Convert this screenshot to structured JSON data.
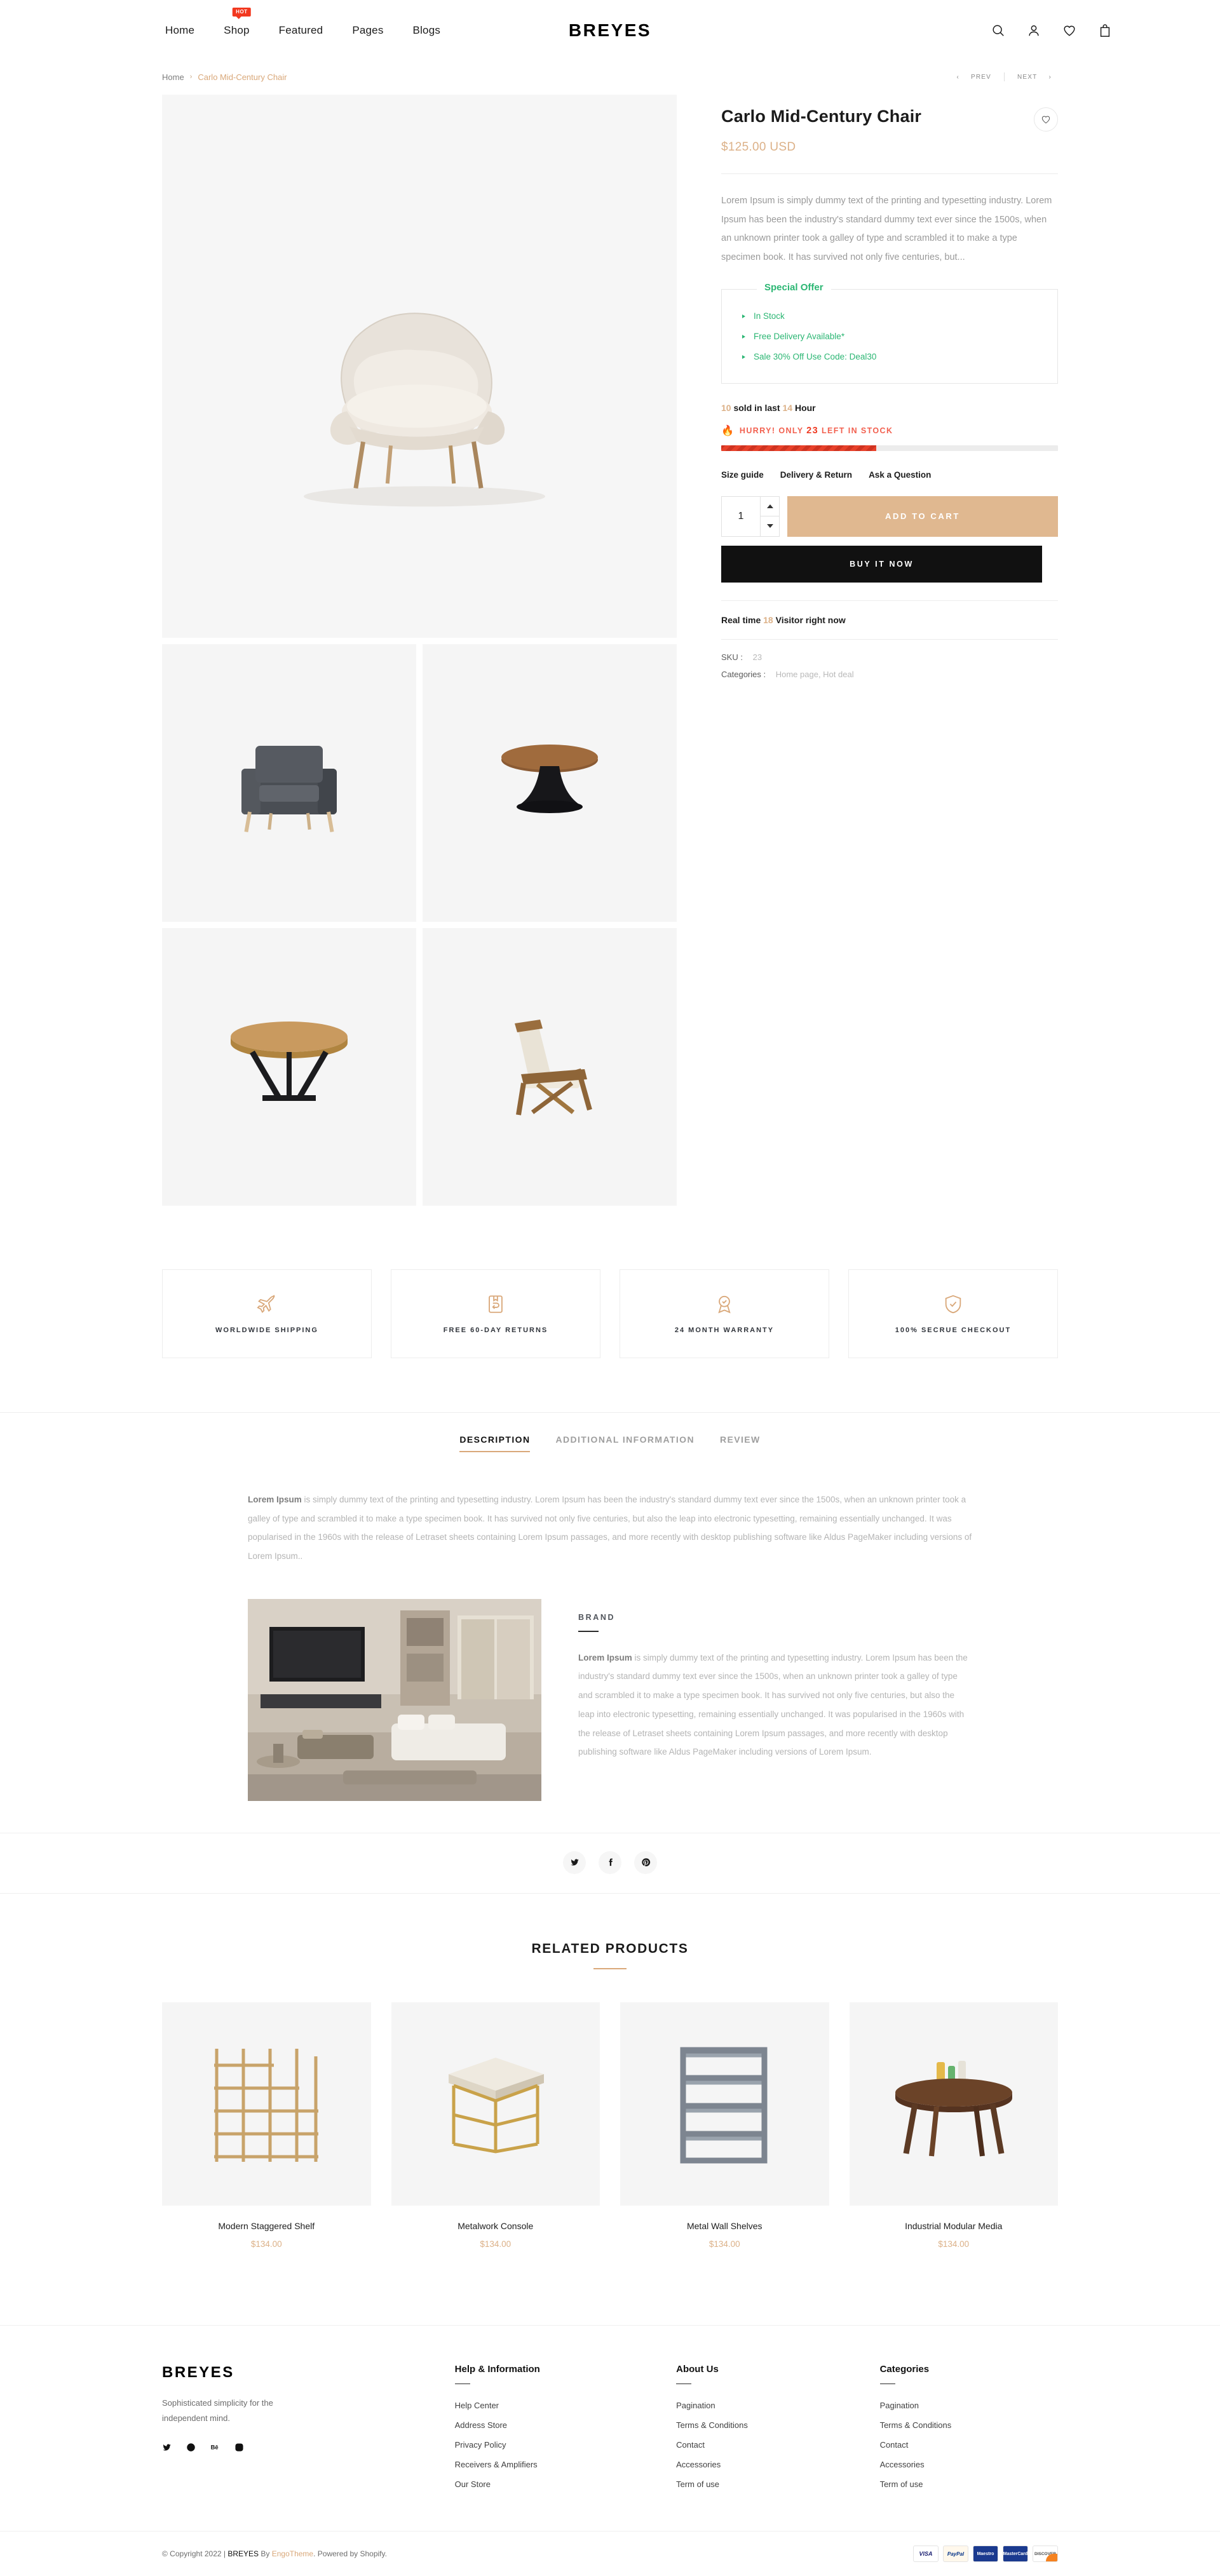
{
  "header": {
    "nav": [
      {
        "label": "Home",
        "badge": null
      },
      {
        "label": "Shop",
        "badge": "HOT"
      },
      {
        "label": "Featured",
        "badge": null
      },
      {
        "label": "Pages",
        "badge": null
      },
      {
        "label": "Blogs",
        "badge": null
      }
    ],
    "logo": "BREYES",
    "icons": [
      "search-icon",
      "account-icon",
      "wishlist-heart-icon",
      "cart-bag-icon"
    ]
  },
  "breadcrumb": {
    "home": "Home",
    "separator": "›",
    "current": "Carlo Mid-Century Chair",
    "prev": "PREV",
    "next": "NEXT"
  },
  "product": {
    "title": "Carlo Mid-Century Chair",
    "price": "$125.00 USD",
    "description": "Lorem Ipsum is simply dummy text of the printing and typesetting industry. Lorem Ipsum has been the industry's standard dummy text ever since the 1500s, when an unknown printer took a galley of type and scrambled it to make a type specimen book. It has survived not only five centuries, but...",
    "offer_title": "Special Offer",
    "offer_items": [
      "In Stock",
      "Free Delivery Available*",
      "Sale 30% Off Use Code: Deal30"
    ],
    "sold_count": "10",
    "sold_mid": "sold in last",
    "sold_hours": "14",
    "sold_unit": "Hour",
    "hurry_prefix": "HURRY! ONLY",
    "hurry_count": "23",
    "hurry_suffix": "LEFT IN STOCK",
    "stock_percent": 46,
    "links": [
      "Size guide",
      "Delivery & Return",
      "Ask a Question"
    ],
    "qty_value": "1",
    "add_to_cart": "ADD TO CART",
    "buy_now": "BUY IT NOW",
    "realtime_prefix": "Real time",
    "realtime_count": "18",
    "realtime_suffix": "Visitor right now",
    "sku_label": "SKU",
    "sku_value": "23",
    "categories_label": "Categories",
    "categories_value": "Home page, Hot deal",
    "accent_color": "#dcb188",
    "alert_color": "#ef3b23",
    "offer_color": "#2bb673"
  },
  "features": [
    {
      "icon": "airplane-icon",
      "label": "WORLDWIDE SHIPPING"
    },
    {
      "icon": "return-box-icon",
      "label": "FREE 60-DAY RETURNS"
    },
    {
      "icon": "award-badge-icon",
      "label": "24 MONTH WARRANTY"
    },
    {
      "icon": "shield-check-icon",
      "label": "100% SECRUE CHECKOUT"
    }
  ],
  "tabs": [
    {
      "label": "DESCRIPTION",
      "active": true
    },
    {
      "label": "ADDITIONAL INFORMATION",
      "active": false
    },
    {
      "label": "REVIEW",
      "active": false
    }
  ],
  "description_tab": {
    "lead": "Lorem Ipsum",
    "body": " is simply dummy text of the printing and typesetting industry. Lorem Ipsum has been the industry's standard dummy text ever since the 1500s, when an unknown printer took a galley of type and scrambled it to make a type specimen book. It has survived not only five centuries, but also the leap into electronic typesetting, remaining essentially unchanged. It was popularised in the 1960s with the release of Letraset sheets containing Lorem Ipsum passages, and more recently with desktop publishing software like Aldus PageMaker including versions of Lorem Ipsum..",
    "brand_heading": "BRAND",
    "brand_lead": "Lorem Ipsum",
    "brand_body": " is simply dummy text of the printing and typesetting industry. Lorem Ipsum has been the industry's standard dummy text ever since the 1500s, when an unknown printer took a galley of type and scrambled it to make a type specimen book. It has survived not only five centuries, but also the leap into electronic typesetting, remaining essentially unchanged. It was popularised in the 1960s with the release of Letraset sheets containing Lorem Ipsum passages, and more recently with desktop publishing software like Aldus PageMaker including versions of Lorem Ipsum."
  },
  "share": [
    "twitter-icon",
    "facebook-icon",
    "pinterest-icon"
  ],
  "related": {
    "title": "RELATED PRODUCTS",
    "prev_arrow": "‹",
    "next_arrow": "›",
    "items": [
      {
        "name": "Modern Staggered Shelf",
        "price": "$134.00"
      },
      {
        "name": "Metalwork Console",
        "price": "$134.00"
      },
      {
        "name": "Metal Wall Shelves",
        "price": "$134.00"
      },
      {
        "name": "Industrial Modular Media",
        "price": "$134.00"
      }
    ]
  },
  "footer": {
    "logo": "BREYES",
    "tagline": "Sophisticated simplicity for the independent mind.",
    "social": [
      "twitter-icon",
      "dribbble-icon",
      "behance-icon",
      "instagram-icon"
    ],
    "columns": [
      {
        "heading": "Help & Information",
        "links": [
          "Help Center",
          "Address Store",
          "Privacy Policy",
          "Receivers & Amplifiers",
          "Our Store"
        ]
      },
      {
        "heading": "About Us",
        "links": [
          "Pagination",
          "Terms & Conditions",
          "Contact",
          "Accessories",
          "Term of use"
        ]
      },
      {
        "heading": "Categories",
        "links": [
          "Pagination",
          "Terms & Conditions",
          "Contact",
          "Accessories",
          "Term of use"
        ]
      }
    ],
    "copyright_pre": "© Copyright 2022 | ",
    "copyright_brand": "BREYES",
    "copyright_mid": " By ",
    "copyright_theme": "EngoTheme",
    "copyright_post": ". Powered by Shopify.",
    "payments": [
      "VISA",
      "PayPal",
      "Maestro",
      "MasterCard",
      "DISCOVER"
    ]
  }
}
